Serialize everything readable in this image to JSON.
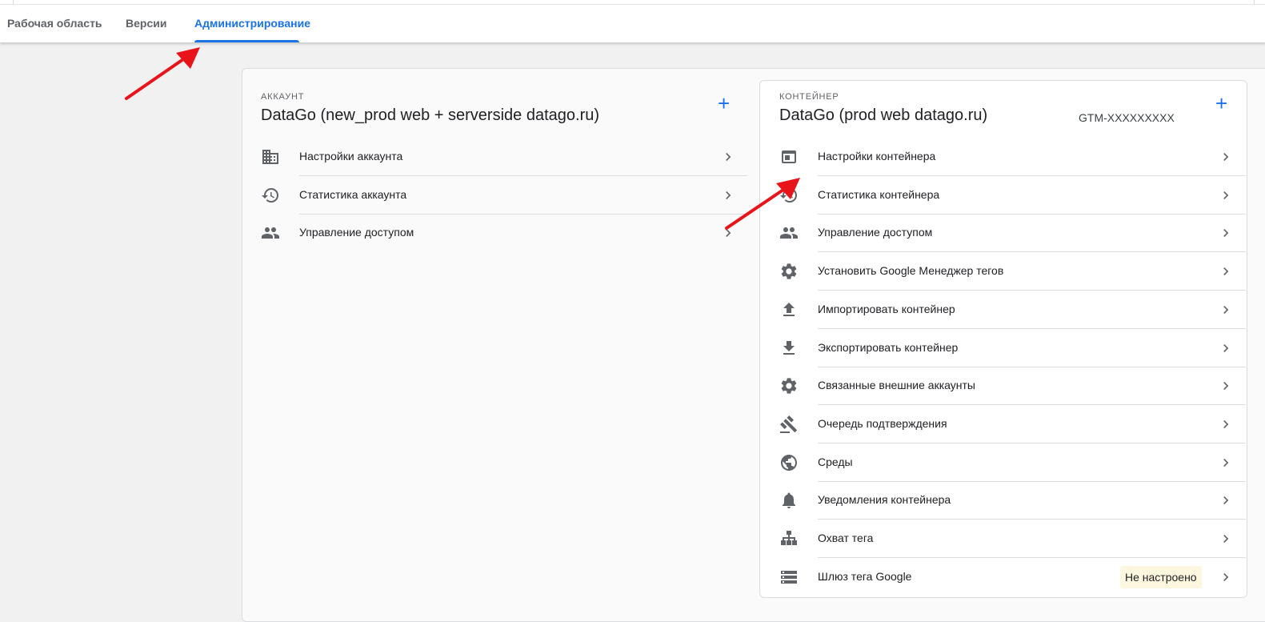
{
  "tabs": {
    "workspace": "Рабочая область",
    "versions": "Версии",
    "admin": "Администрирование"
  },
  "account": {
    "section_label": "АККАУНТ",
    "name": "DataGo (new_prod web + serverside datago.ru)",
    "add_label": "+",
    "items": [
      {
        "label": "Настройки аккаунта",
        "icon": "building-icon"
      },
      {
        "label": "Статистика аккаунта",
        "icon": "history-icon"
      },
      {
        "label": "Управление доступом",
        "icon": "people-icon"
      }
    ]
  },
  "container": {
    "section_label": "КОНТЕЙНЕР",
    "name": "DataGo (prod web datago.ru)",
    "id": "GTM-XXXXXXXXX",
    "add_label": "+",
    "items": [
      {
        "label": "Настройки контейнера",
        "icon": "web-asset-icon"
      },
      {
        "label": "Статистика контейнера",
        "icon": "history-icon"
      },
      {
        "label": "Управление доступом",
        "icon": "people-icon"
      },
      {
        "label": "Установить Google Менеджер тегов",
        "icon": "gear-icon"
      },
      {
        "label": "Импортировать контейнер",
        "icon": "upload-icon"
      },
      {
        "label": "Экспортировать контейнер",
        "icon": "download-icon"
      },
      {
        "label": "Связанные внешние аккаунты",
        "icon": "gear-icon"
      },
      {
        "label": "Очередь подтверждения",
        "icon": "gavel-icon"
      },
      {
        "label": "Среды",
        "icon": "globe-icon"
      },
      {
        "label": "Уведомления контейнера",
        "icon": "bell-icon"
      },
      {
        "label": "Охват тега",
        "icon": "hierarchy-icon"
      },
      {
        "label": "Шлюз тега Google",
        "icon": "storage-icon",
        "badge": "Не настроено"
      }
    ]
  },
  "colors": {
    "accent": "#1a73e8",
    "annotation_arrow": "#e8141a",
    "badge_bg": "#fef7e0"
  }
}
